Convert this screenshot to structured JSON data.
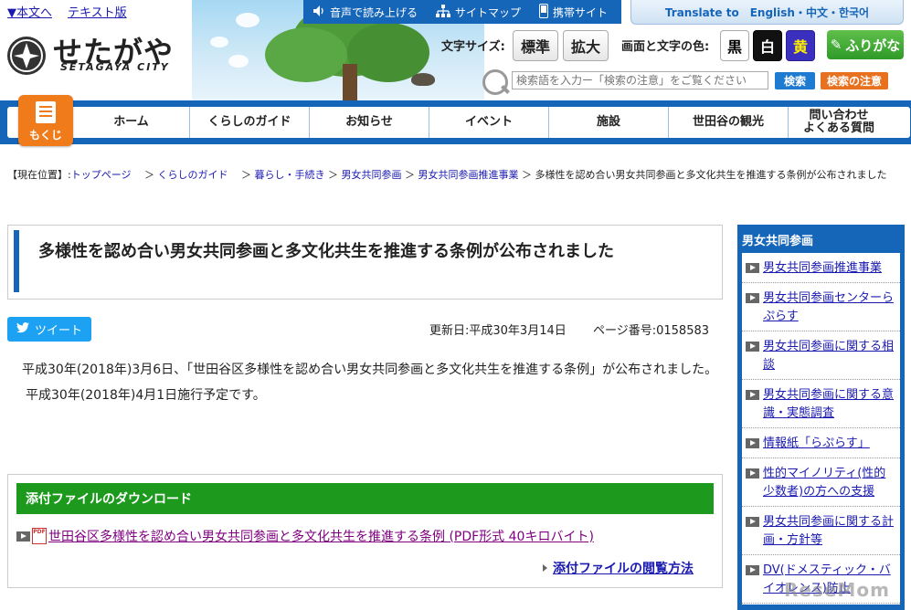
{
  "header": {
    "skip_links": [
      "▼本文へ",
      "テキスト版"
    ],
    "logo_text": "せたがや",
    "logo_sub": "SETAGAYA CITY",
    "topbar": [
      "音声で読み上げる",
      "サイトマップ",
      "携帯サイト"
    ],
    "translate": "Translate to　English・中文・한국어",
    "font_size_label": "文字サイズ:",
    "font_size_options": [
      "標準",
      "拡大"
    ],
    "color_label": "画面と文字の色:",
    "color_options": [
      {
        "label": "黒",
        "bg": "#ffffff",
        "fg": "#000000"
      },
      {
        "label": "白",
        "bg": "#111111",
        "fg": "#ffffff"
      },
      {
        "label": "黄",
        "bg": "#3a2fbf",
        "fg": "#ffee00"
      }
    ],
    "furigana": "ふりがな",
    "search_placeholder": "検索語を入力ー「検索の注意」をご覧ください",
    "search_button": "検索",
    "search_caution": "検索の注意"
  },
  "nav": {
    "mokuji": "もくじ",
    "items": [
      "ホーム",
      "くらしのガイド",
      "お知らせ",
      "イベント",
      "施設",
      "世田谷の観光",
      "問い合わせ\nよくある質問"
    ]
  },
  "breadcrumb": {
    "prefix": "【現在位置】:",
    "links": [
      "トップページ",
      "くらしのガイド",
      "暮らし・手続き",
      "男女共同参画",
      "男女共同参画推進事業"
    ],
    "current": "多様性を認め合い男女共同参画と多文化共生を推進する条例が公布されました"
  },
  "main": {
    "title": "多様性を認め合い男女共同参画と多文化共生を推進する条例が公布されました",
    "tweet": "ツイート",
    "updated": "更新日:平成30年3月14日",
    "page_no": "ページ番号:0158583",
    "para1": "平成30年(2018年)3月6日、「世田谷区多様性を認め合い男女共同参画と多文化共生を推進する条例」が公布されました。",
    "para2": "平成30年(2018年)4月1日施行予定です。",
    "attach_heading": "添付ファイルのダウンロード",
    "attach_link": "世田谷区多様性を認め合い男女共同参画と多文化共生を推進する条例 (PDF形式 40キロバイト)",
    "attach_howto": "添付ファイルの閲覧方法"
  },
  "sidebar": {
    "heading": "男女共同参画",
    "items": [
      "男女共同参画推進事業",
      "男女共同参画センターらぷらす",
      "男女共同参画に関する相談",
      "男女共同参画に関する意識・実態調査",
      "情報紙「らぷらす」",
      "性的マイノリティ(性的少数者)の方への支援",
      "男女共同参画に関する計画・方針等",
      "DV(ドメスティック・バイオレンス)防止"
    ]
  },
  "watermark": "ReseMom"
}
